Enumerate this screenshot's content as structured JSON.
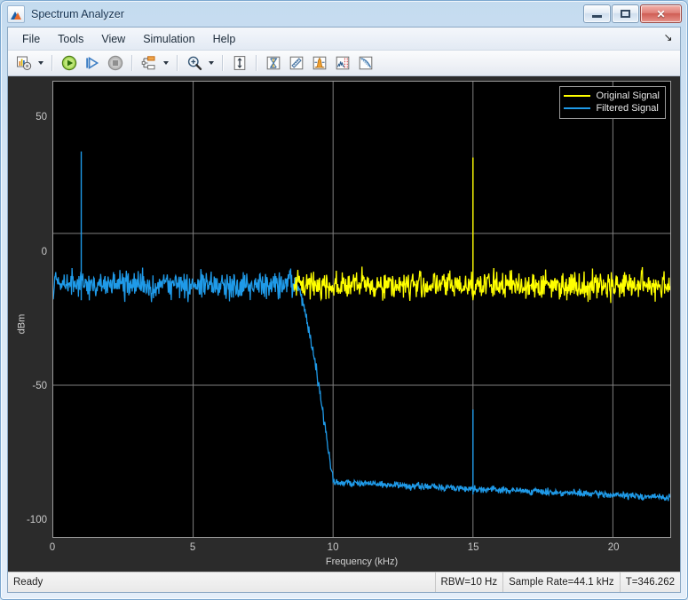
{
  "window": {
    "title": "Spectrum Analyzer",
    "app_icon": "matlab-scope-icon",
    "controls": [
      {
        "name": "minimize-button",
        "glyph": "minimize"
      },
      {
        "name": "maximize-button",
        "glyph": "maximize"
      },
      {
        "name": "close-button",
        "glyph": "✕"
      }
    ]
  },
  "menu": {
    "items": [
      {
        "label": "File"
      },
      {
        "label": "Tools"
      },
      {
        "label": "View"
      },
      {
        "label": "Simulation"
      },
      {
        "label": "Help"
      }
    ],
    "overflow_icon": "expand-arrow-icon",
    "overflow_glyph": "↘"
  },
  "toolbar": {
    "buttons": [
      {
        "name": "configuration-properties-button",
        "icon": "scope-config-icon",
        "dropdown": true
      },
      {
        "name": "run-button",
        "icon": "play-icon",
        "dropdown": false
      },
      {
        "name": "step-forward-button",
        "icon": "step-forward-icon",
        "dropdown": false
      },
      {
        "name": "stop-button",
        "icon": "stop-icon",
        "dropdown": false
      },
      {
        "name": "signal-selection-button",
        "icon": "signal-selector-icon",
        "dropdown": true
      },
      {
        "name": "zoom-in-button",
        "icon": "zoom-in-icon",
        "dropdown": true
      },
      {
        "name": "autoscale-button",
        "icon": "autoscale-icon",
        "dropdown": false
      },
      {
        "name": "cursor-measurements-button",
        "icon": "cursor-measurements-icon",
        "dropdown": false
      },
      {
        "name": "distance-measurement-button",
        "icon": "distance-ruler-icon",
        "dropdown": false
      },
      {
        "name": "peak-finder-button",
        "icon": "peak-finder-icon",
        "dropdown": false
      },
      {
        "name": "channel-measurements-button",
        "icon": "channel-measurements-icon",
        "dropdown": false
      },
      {
        "name": "spectral-mask-button",
        "icon": "spectral-mask-icon",
        "dropdown": false
      }
    ]
  },
  "statusbar": {
    "ready": "Ready",
    "rbw": "RBW=10 Hz",
    "sample_rate": "Sample Rate=44.1 kHz",
    "time": "T=346.262"
  },
  "colors": {
    "plot_background": "#000000",
    "grid": "#808080",
    "original_signal": "#ffff00",
    "filtered_signal": "#1f9ae8",
    "axes_text": "#c9c9c9",
    "panel_background": "#2b2b2b",
    "title_text": "#12304f",
    "close_button": "#cf5d54"
  },
  "chart_data": {
    "type": "line",
    "title": "",
    "xlabel": "Frequency (kHz)",
    "ylabel": "dBm",
    "xlim": [
      0,
      22.05
    ],
    "ylim": [
      -100,
      50
    ],
    "xticks": [
      0,
      5,
      10,
      15,
      20
    ],
    "xtick_labels": [
      "0",
      "5",
      "10",
      "15",
      "20"
    ],
    "yticks": [
      50,
      0,
      -50,
      -100
    ],
    "ytick_labels": [
      "50",
      "0",
      "-50",
      "-100"
    ],
    "grid": true,
    "legend_position": "top-right",
    "legend": [
      "Original Signal",
      "Filtered Signal"
    ],
    "series": [
      {
        "name": "Original Signal",
        "color": "#ffff00",
        "description": "Broadband white noise floor near -17 dBm spanning roughly 8.6 kHz to 22.05 kHz with a strong tone at 15 kHz reaching +25 dBm.",
        "noise_floor_dbm": -17,
        "noise_spread_db": 9,
        "visible_range_khz": [
          8.6,
          22.05
        ],
        "tones": [
          {
            "frequency_khz": 15.0,
            "peak_dbm": 25
          }
        ]
      },
      {
        "name": "Filtered Signal",
        "color": "#1f9ae8",
        "description": "Lowpass filtered noise: passband floor near -17 dBm from 0 to 8.7 kHz, transition band rolling off from 8.7 kHz to 10 kHz, stopband floor near -82 dBm decaying to -87 dBm by 22 kHz. Tone at 1 kHz at +27 dBm passes; residual of the 15 kHz tone appears at -58 dBm.",
        "passband_floor_dbm": -17,
        "stopband_floor_dbm": -85,
        "cutoff_khz": 9.6,
        "transition_start_khz": 8.7,
        "transition_end_khz": 10.0,
        "tones": [
          {
            "frequency_khz": 1.0,
            "peak_dbm": 27
          },
          {
            "frequency_khz": 15.0,
            "peak_dbm": -58
          }
        ]
      }
    ]
  }
}
